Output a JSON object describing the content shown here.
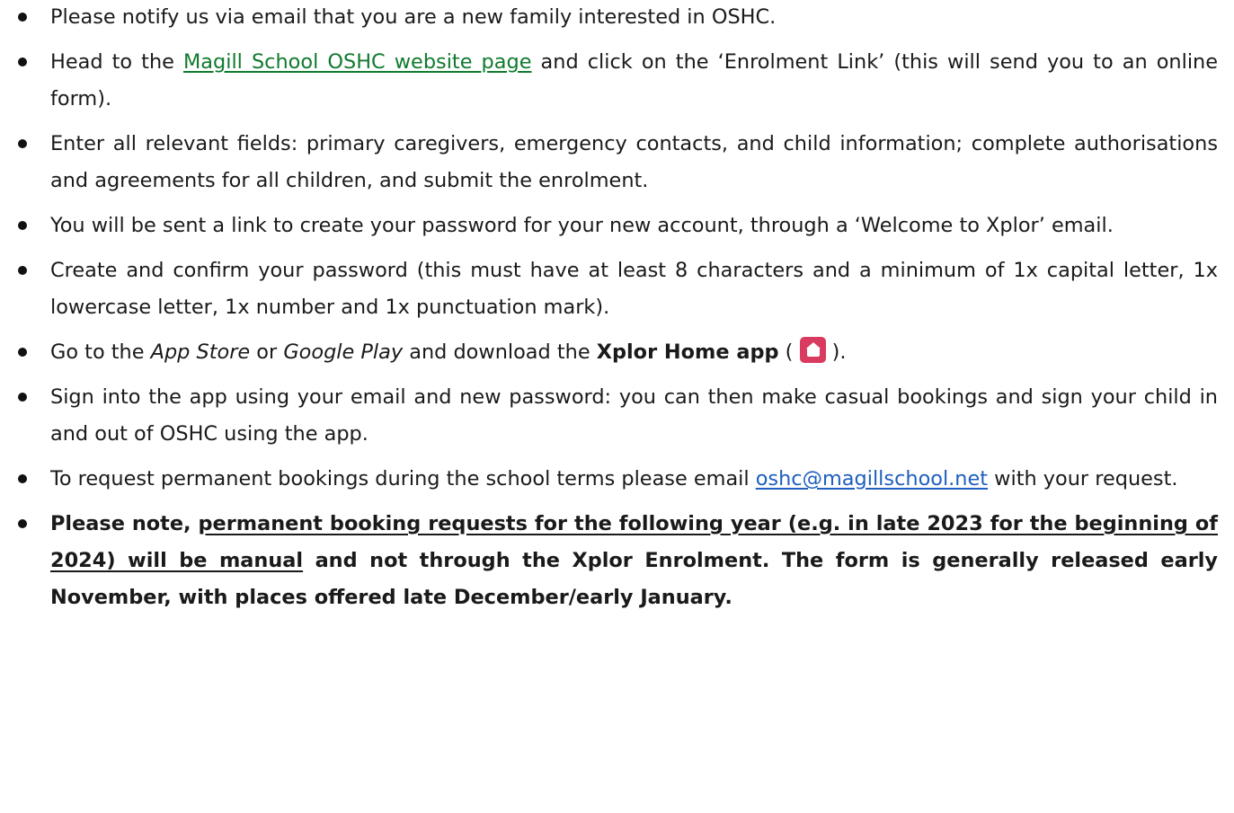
{
  "steps": [
    {
      "text": "Please notify us via email that you are a new family interested in OSHC."
    },
    {
      "before": "Head to the ",
      "link": "Magill School OSHC website page",
      "after": " and click on the ‘Enrolment Link’ (this will send you to an online form)."
    },
    {
      "text": "Enter all relevant fields: primary caregivers, emergency contacts, and child information; complete authorisations and agreements for all children, and submit the enrolment."
    },
    {
      "text": "You will be sent a link to create your password for your new account, through a ‘Welcome to Xplor’ email."
    },
    {
      "text": "Create and confirm your password (this must have at least 8 characters and a minimum of 1x capital letter, 1x lowercase letter, 1x number and 1x punctuation mark)."
    },
    {
      "a": "Go to the ",
      "app_store": "App Store",
      "or": " or ",
      "google_play": "Google Play",
      "mid": " and download the ",
      "app_name": "Xplor Home app",
      "open_paren": " (",
      "close_paren": ")."
    },
    {
      "text": "Sign into the app using your email and new password: you can then make casual bookings and sign your child in and out of OSHC using the app."
    },
    {
      "before": "To request permanent bookings during the school terms please email ",
      "email": "oshc@magillschool.net",
      "after": " with your request."
    },
    {
      "lead": "Please note, ",
      "underlined": "permanent booking requests for the following year (e.g. in late 2023 for the beginning of 2024) will be manual",
      "rest": " and not through the Xplor Enrolment. The form is generally released early November, with places offered late December/early January."
    }
  ],
  "icons": {
    "app_icon": "xplor-home-app-icon"
  },
  "colors": {
    "link_green": "#107a2e",
    "link_blue": "#1f5fbf",
    "app_icon": "#d93a5f"
  }
}
